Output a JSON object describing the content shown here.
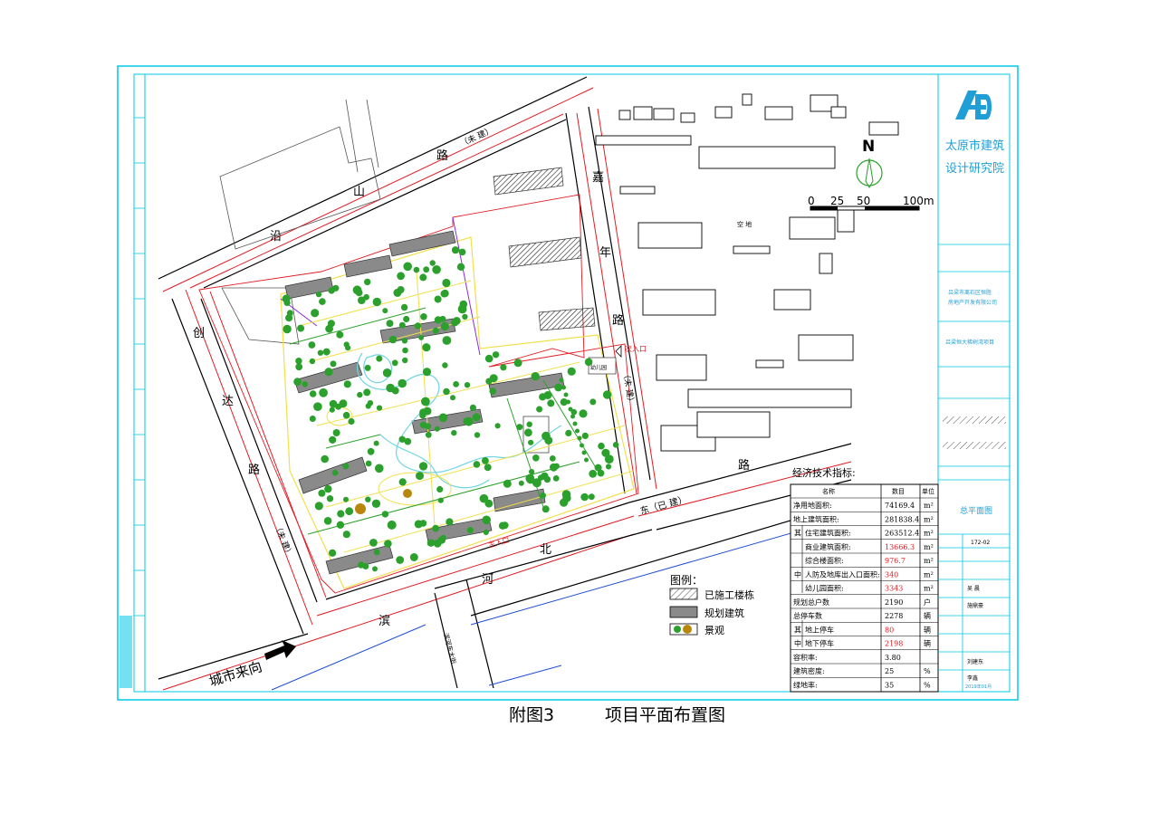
{
  "caption": {
    "figure_no": "附图3",
    "title": "项目平面布置图"
  },
  "map": {
    "roads": {
      "north": "沿 山 路（未 建）",
      "north_chars": [
        "沿",
        "山",
        "路",
        "（未 建）"
      ],
      "west": "创 达 路（未 建）",
      "west_chars": [
        "创",
        "达",
        "路",
        "（未 建）"
      ],
      "east": "嘉 年 路（未 建）",
      "east_chars": [
        "嘉",
        "年",
        "路",
        "（未 建）"
      ],
      "south": "滨 河 北 路",
      "south_chars": [
        "滨",
        "河",
        "北",
        "路"
      ],
      "southeast": "东（已 建）",
      "south_road2": "滨河东大街"
    },
    "entrances": {
      "main": "主入口",
      "secondary": "次入口"
    },
    "city_arrival": "城市来向",
    "open_space": "空 地",
    "kindergarten": "幼儿园"
  },
  "north_arrow": {
    "letter": "N"
  },
  "scale_bar": {
    "labels": [
      "0",
      "25",
      "50",
      "100m"
    ]
  },
  "legend": {
    "title": "图例：",
    "items": [
      {
        "label": "已施工楼栋",
        "symbol": "hatched-box"
      },
      {
        "label": "规划建筑",
        "symbol": "grey-box"
      },
      {
        "label": "景观",
        "symbol": "tree-dots"
      }
    ]
  },
  "tech_table": {
    "title": "经济技术指标:",
    "headers": [
      "名称",
      "数目",
      "单位"
    ],
    "rows": [
      {
        "group": "",
        "name": "净用地面积:",
        "value": "74169.4",
        "unit": "m²",
        "highlight": false
      },
      {
        "group": "",
        "name": "地上建筑面积:",
        "value": "281838.4",
        "unit": "m²",
        "highlight": false
      },
      {
        "group": "其",
        "name": "住宅建筑面积:",
        "value": "263512.4",
        "unit": "m²",
        "highlight": false
      },
      {
        "group": "",
        "name": "商业建筑面积:",
        "value": "13666.3",
        "unit": "m²",
        "highlight": true
      },
      {
        "group": "",
        "name": "综合楼面积:",
        "value": "976.7",
        "unit": "m²",
        "highlight": true
      },
      {
        "group": "中",
        "name": "人防及地库出入口面积:",
        "value": "340",
        "unit": "m²",
        "highlight": true
      },
      {
        "group": "",
        "name": "幼儿园面积:",
        "value": "3343",
        "unit": "m²",
        "highlight": true
      },
      {
        "group": "",
        "name": "规划总户数",
        "value": "2190",
        "unit": "户",
        "highlight": false
      },
      {
        "group": "",
        "name": "总停车数",
        "value": "2278",
        "unit": "辆",
        "highlight": false
      },
      {
        "group": "其",
        "name": "地上停车",
        "value": "80",
        "unit": "辆",
        "highlight": true
      },
      {
        "group": "中",
        "name": "地下停车",
        "value": "2198",
        "unit": "辆",
        "highlight": true
      },
      {
        "group": "",
        "name": "容积率:",
        "value": "3.80",
        "unit": "",
        "highlight": false
      },
      {
        "group": "",
        "name": "建筑密度:",
        "value": "25",
        "unit": "%",
        "highlight": false
      },
      {
        "group": "",
        "name": "绿地率:",
        "value": "35",
        "unit": "%",
        "highlight": false
      }
    ]
  },
  "title_block": {
    "institute_line1": "太原市建筑",
    "institute_line2": "设计研究院",
    "client": "吕梁市离石区恒胜\n房地产开发有限公司",
    "client_line1": "吕梁市离石区恒胜",
    "client_line2": "房地产开发有限公司",
    "project": "吕梁恒大稀树湾项目",
    "drawing_name": "总平面图",
    "drawing_no": "172-02",
    "date": "2019年01月",
    "stamp_words": [
      "吴 晨",
      "施鼎豪",
      "刘建东",
      "李鑫"
    ]
  },
  "colors": {
    "frame": "#00c8e6",
    "road_red": "#e31b23",
    "road_black": "#000000",
    "landscape_green": "#2ca02c",
    "water_cyan": "#6fd4e0",
    "path_yellow": "#f1e04a",
    "building_grey": "#7b7b7b",
    "institute_blue": "#1f9fd6",
    "highlight_red": "#e31b23"
  }
}
